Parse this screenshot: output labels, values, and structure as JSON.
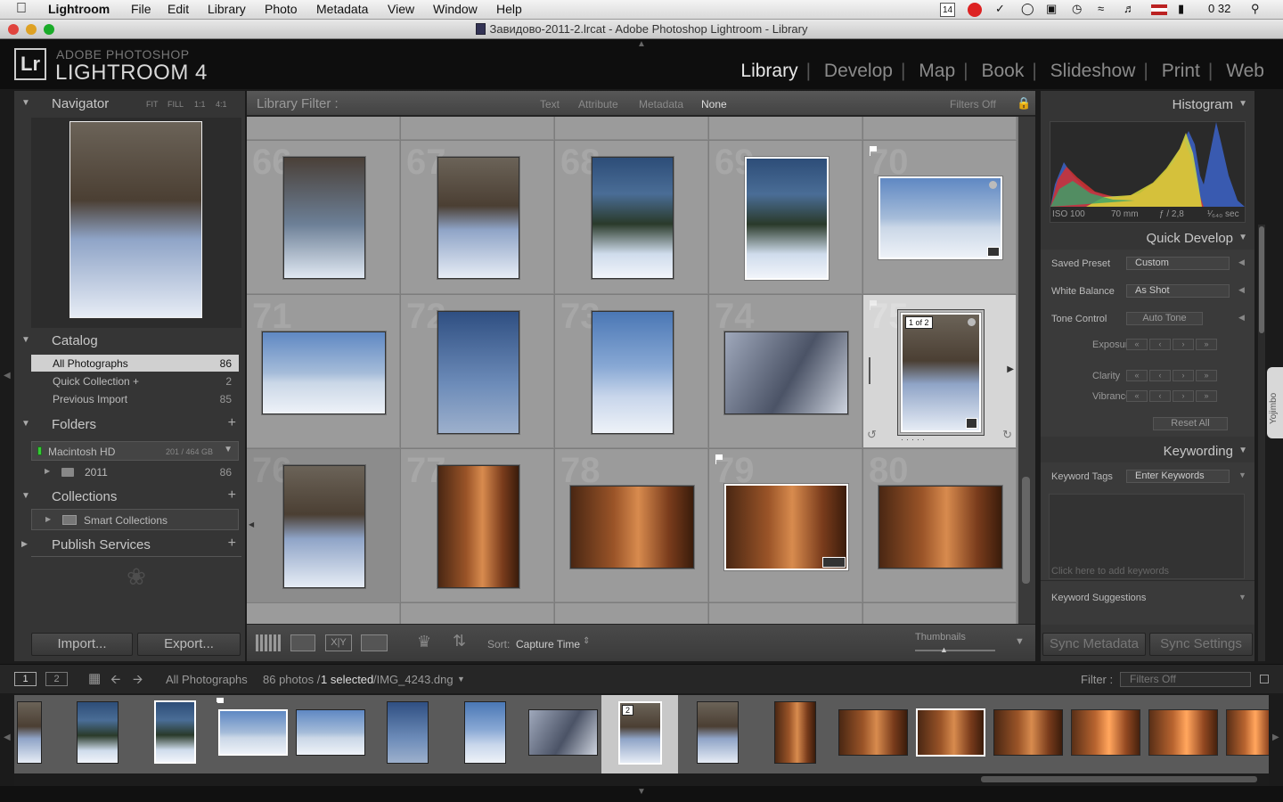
{
  "menubar": {
    "items": [
      "Lightroom",
      "File",
      "Edit",
      "Library",
      "Photo",
      "Metadata",
      "View",
      "Window",
      "Help"
    ],
    "calendar_day": "14",
    "clock": "0 32"
  },
  "window": {
    "title": "Завидово-2011-2.lrcat - Adobe Photoshop Lightroom - Library"
  },
  "identity": {
    "brand_small": "ADOBE PHOTOSHOP",
    "brand_large": "LIGHTROOM 4",
    "logo": "Lr"
  },
  "modules": {
    "items": [
      "Library",
      "Develop",
      "Map",
      "Book",
      "Slideshow",
      "Print",
      "Web"
    ],
    "active": "Library"
  },
  "navigator": {
    "title": "Navigator",
    "zoom_options": [
      "FIT",
      "FILL",
      "1:1",
      "4:1"
    ]
  },
  "catalog": {
    "title": "Catalog",
    "items": [
      {
        "label": "All Photographs",
        "count": "86"
      },
      {
        "label": "Quick Collection +",
        "count": "2"
      },
      {
        "label": "Previous Import",
        "count": "85"
      }
    ]
  },
  "folders": {
    "title": "Folders",
    "volume": "Macintosh HD",
    "volume_space": "201 / 464 GB",
    "items": [
      {
        "label": "2011",
        "count": "86"
      }
    ]
  },
  "collections": {
    "title": "Collections",
    "items": [
      {
        "label": "Smart Collections"
      }
    ]
  },
  "publish": {
    "title": "Publish Services"
  },
  "left_buttons": {
    "import": "Import...",
    "export": "Export..."
  },
  "filter": {
    "label": "Library Filter :",
    "tabs": [
      "Text",
      "Attribute",
      "Metadata",
      "None"
    ],
    "active_tab": "None",
    "filters_state": "Filters Off"
  },
  "grid": {
    "cell_numbers": [
      "66",
      "67",
      "68",
      "69",
      "70",
      "71",
      "72",
      "73",
      "74",
      "75",
      "76",
      "77",
      "78",
      "79",
      "80"
    ],
    "stack_badge": "1 of 2"
  },
  "toolbar": {
    "sort_label": "Sort:",
    "sort_value": "Capture Time",
    "thumbnails_label": "Thumbnails"
  },
  "histogram": {
    "title": "Histogram",
    "iso": "ISO 100",
    "focal": "70 mm",
    "aperture": "ƒ / 2,8",
    "shutter": "¹⁄₆₄₀ sec"
  },
  "quick_develop": {
    "title": "Quick Develop",
    "saved_preset_label": "Saved Preset",
    "saved_preset_value": "Custom",
    "white_balance_label": "White Balance",
    "white_balance_value": "As Shot",
    "tone_control_label": "Tone Control",
    "auto_tone": "Auto Tone",
    "exposure_label": "Exposure",
    "clarity_label": "Clarity",
    "vibrance_label": "Vibrance",
    "reset_all": "Reset All"
  },
  "keywording": {
    "title": "Keywording",
    "tags_label": "Keyword Tags",
    "tags_value": "Enter Keywords",
    "placeholder": "Click here to add keywords",
    "suggestions": "Keyword Suggestions"
  },
  "sync": {
    "metadata": "Sync Metadata",
    "settings": "Sync Settings"
  },
  "side_tab": "Yojimbo",
  "filmstrip_bar": {
    "screen1": "1",
    "screen2": "2",
    "source": "All Photographs",
    "count_text": "86 photos /",
    "selected_text": "1 selected",
    "file_text": "/IMG_4243.dng",
    "filter_label": "Filter :",
    "filter_value": "Filters Off"
  },
  "filmstrip": {
    "stack_badge": "2"
  },
  "colors": {
    "panel_bg": "#353535",
    "grid_bg": "#9b9b9b",
    "selected_cell": "#d6d6d6",
    "active_module": "#e8e8e8"
  }
}
